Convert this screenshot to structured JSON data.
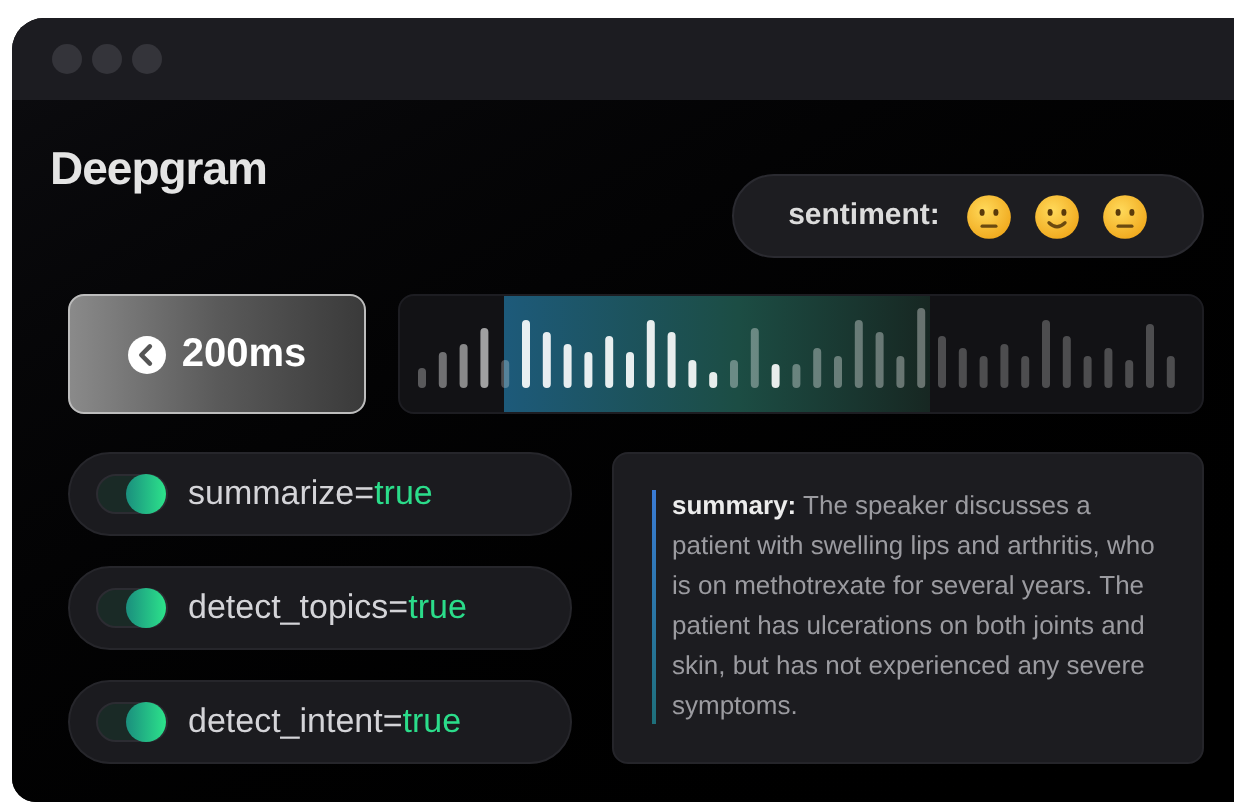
{
  "logo": "Deepgram",
  "sentiment": {
    "label": "sentiment:",
    "faces": [
      {
        "kind": "neutral"
      },
      {
        "kind": "smile"
      },
      {
        "kind": "neutral"
      }
    ]
  },
  "delay_button": {
    "label": "200ms"
  },
  "options": [
    {
      "label": "summarize=",
      "value": "true",
      "on": true
    },
    {
      "label": "detect_topics=",
      "value": "true",
      "on": true
    },
    {
      "label": "detect_intent=",
      "value": "true",
      "on": true
    }
  ],
  "summary": "**summary:** The speaker discusses a patient with swelling lips and arthritis, who is on methotrexate for several years. The patient has ulcerations on both joints and skin, but has not experienced any severe symptoms."
}
